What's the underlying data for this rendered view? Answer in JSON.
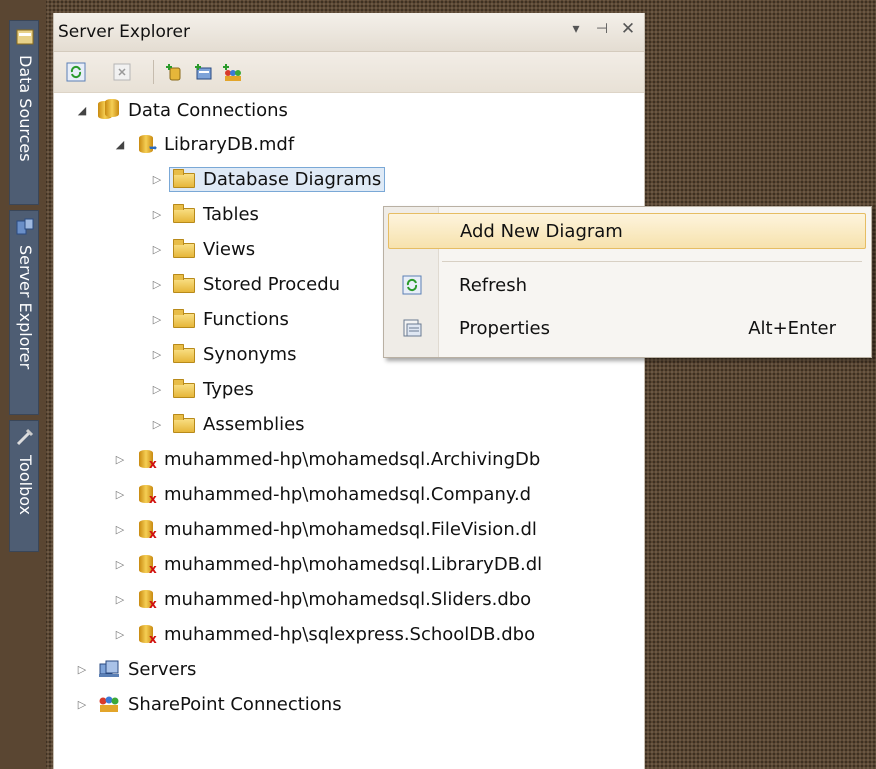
{
  "dock": {
    "tabs": [
      {
        "label": "Data Sources",
        "icon": "data-sources-icon"
      },
      {
        "label": "Server Explorer",
        "icon": "server-explorer-icon"
      },
      {
        "label": "Toolbox",
        "icon": "toolbox-icon"
      }
    ]
  },
  "panel": {
    "title": "Server Explorer",
    "controls": [
      "dropdown-icon",
      "pin-icon",
      "close-icon"
    ],
    "toolbar": [
      "refresh-icon",
      "stop-icon",
      "add-connection-icon",
      "connect-server-icon",
      "sharepoint-connect-icon"
    ]
  },
  "tree": {
    "data_connections": "Data Connections",
    "library_db": "LibraryDB.mdf",
    "folders": [
      "Database Diagrams",
      "Tables",
      "Views",
      "Stored Procedu",
      "Functions",
      "Synonyms",
      "Types",
      "Assemblies"
    ],
    "connections": [
      "muhammed-hp\\mohamedsql.ArchivingDb",
      "muhammed-hp\\mohamedsql.Company.d",
      "muhammed-hp\\mohamedsql.FileVision.dl",
      "muhammed-hp\\mohamedsql.LibraryDB.dl",
      "muhammed-hp\\mohamedsql.Sliders.dbo",
      "muhammed-hp\\sqlexpress.SchoolDB.dbo"
    ],
    "servers": "Servers",
    "sharepoint": "SharePoint Connections"
  },
  "context_menu": {
    "items": [
      {
        "label": "Add New Diagram",
        "shortcut": ""
      },
      {
        "label": "Refresh",
        "shortcut": ""
      },
      {
        "label": "Properties",
        "shortcut": "Alt+Enter"
      }
    ]
  }
}
